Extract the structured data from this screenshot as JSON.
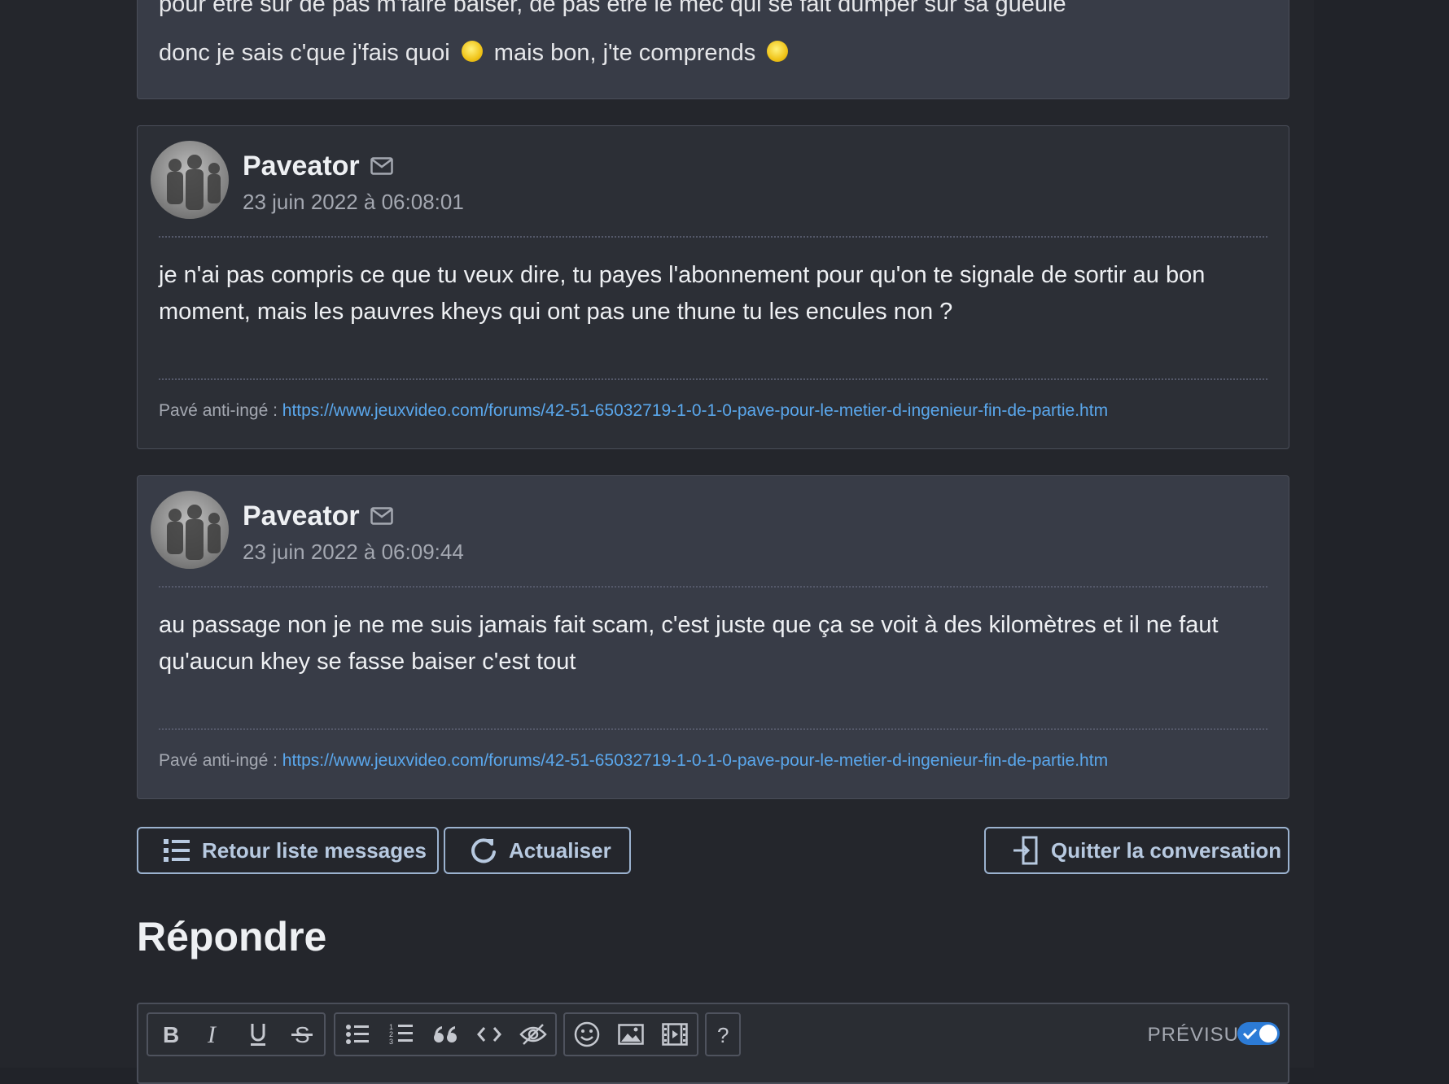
{
  "messages": [
    {
      "author": "Paveator",
      "date": "23 juin 2022 à 06:08:01",
      "body": "je n'ai pas compris ce que tu veux dire, tu payes l'abonnement pour qu'on te signale de sortir au bon moment, mais les pauvres kheys qui ont pas une thune tu les encules non ?",
      "sig_label": "Pavé anti-ingé : ",
      "sig_link": "https://www.jeuxvideo.com/forums/42-51-65032719-1-0-1-0-pave-pour-le-metier-d-ingenieur-fin-de-partie.htm"
    },
    {
      "author": "Paveator",
      "date": "23 juin 2022 à 06:09:44",
      "body": "au passage non je ne me suis jamais fait scam, c'est juste que ça se voit à des kilomètres et il ne faut qu'aucun khey se fasse baiser c'est tout",
      "sig_label": "Pavé anti-ingé : ",
      "sig_link": "https://www.jeuxvideo.com/forums/42-51-65032719-1-0-1-0-pave-pour-le-metier-d-ingenieur-fin-de-partie.htm"
    }
  ],
  "previous": {
    "cut_line": "pour être sûr de pas m'faire baiser, de pas être le mec qui se fait dumper sur sa gueule",
    "part1": "donc je sais c'que j'fais quoi",
    "part2": "mais bon, j'te comprends"
  },
  "actions": {
    "back": "Retour liste messages",
    "refresh": "Actualiser",
    "leave": "Quitter la conversation"
  },
  "reply": {
    "heading": "Répondre",
    "preview_label": "PRÉVISU",
    "preview_on": true
  },
  "colors": {
    "background": "#24262c",
    "card": "#383c47",
    "link": "#5aa7ec",
    "button_border": "#9bb2cf",
    "toggle": "#2c7bd6"
  }
}
